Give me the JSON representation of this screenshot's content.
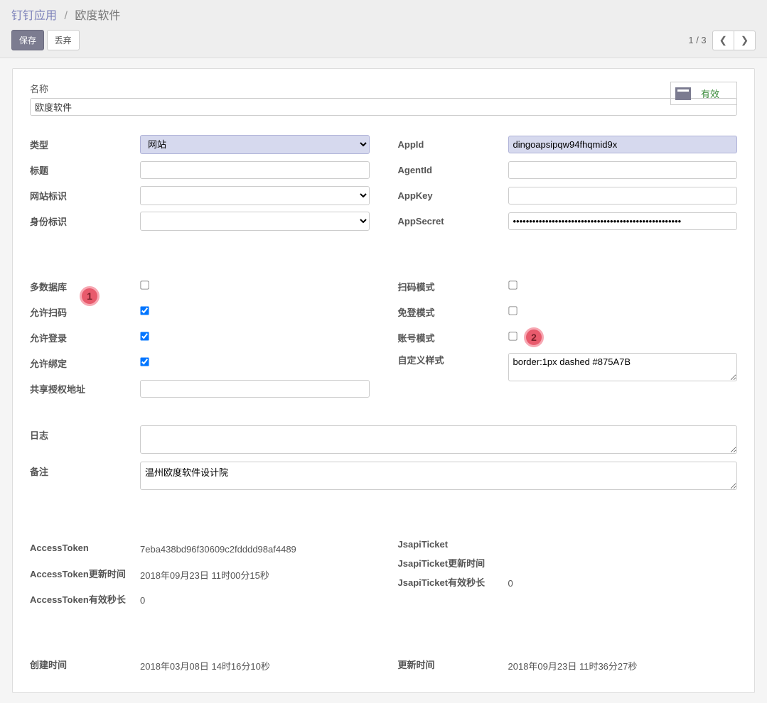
{
  "breadcrumb": {
    "parent": "钉钉应用",
    "current": "欧度软件"
  },
  "buttons": {
    "save": "保存",
    "discard": "丢弃"
  },
  "pager": {
    "text": "1 / 3"
  },
  "status": {
    "label": "有效"
  },
  "title": {
    "label": "名称",
    "value": "欧度软件"
  },
  "left1": {
    "type_label": "类型",
    "type_value": "网站",
    "subject_label": "标题",
    "subject_value": "",
    "website_label": "网站标识",
    "website_value": "",
    "identity_label": "身份标识",
    "identity_value": ""
  },
  "right1": {
    "appid_label": "AppId",
    "appid_value": "dingoapsipqw94fhqmid9x",
    "agentid_label": "AgentId",
    "agentid_value": "",
    "appkey_label": "AppKey",
    "appkey_value": "",
    "appsecret_label": "AppSecret",
    "appsecret_value": "••••••••••••••••••••••••••••••••••••••••••••••••••••"
  },
  "left2": {
    "multidb_label": "多数据库",
    "multidb_checked": false,
    "scan_label": "允许扫码",
    "scan_checked": true,
    "login_label": "允许登录",
    "login_checked": true,
    "bind_label": "允许绑定",
    "bind_checked": true,
    "share_label": "共享授权地址",
    "share_value": ""
  },
  "right2": {
    "scanmode_label": "扫码模式",
    "scanmode_checked": false,
    "noauth_label": "免登模式",
    "noauth_checked": false,
    "account_label": "账号模式",
    "account_checked": false,
    "style_label": "自定义样式",
    "style_value": "border:1px dashed #875A7B"
  },
  "wide": {
    "log_label": "日志",
    "log_value": "",
    "note_label": "备注",
    "note_value": "温州欧度软件设计院"
  },
  "left3": {
    "token_label": "AccessToken",
    "token_value": "7eba438bd96f30609c2fdddd98af4489",
    "token_update_label": "AccessToken更新时间",
    "token_update_value": "2018年09月23日 11时00分15秒",
    "token_ttl_label": "AccessToken有效秒长",
    "token_ttl_value": "0"
  },
  "right3": {
    "ticket_label": "JsapiTicket",
    "ticket_value": "",
    "ticket_update_label": "JsapiTicket更新时间",
    "ticket_update_value": "",
    "ticket_ttl_label": "JsapiTicket有效秒长",
    "ticket_ttl_value": "0"
  },
  "left4": {
    "created_label": "创建时间",
    "created_value": "2018年03月08日 14时16分10秒"
  },
  "right4": {
    "updated_label": "更新时间",
    "updated_value": "2018年09月23日 11时36分27秒"
  },
  "annotations": {
    "one": "1",
    "two": "2"
  }
}
